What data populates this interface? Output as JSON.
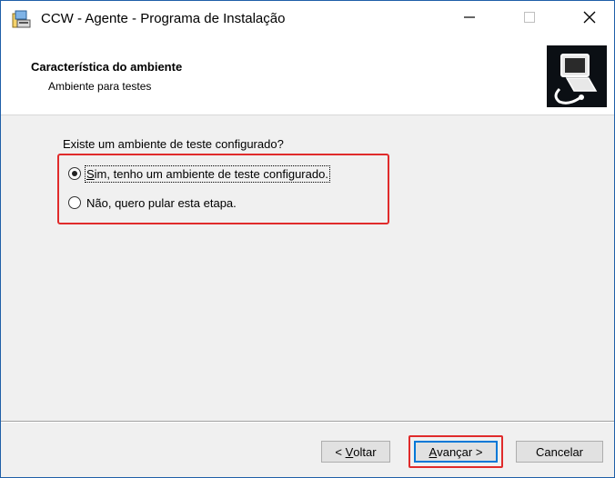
{
  "window": {
    "title": "CCW - Agente - Programa de Instalação",
    "controls": {
      "minimize_glyph": "—",
      "maximize_glyph": "☐",
      "close_glyph": "✕"
    }
  },
  "header": {
    "title": "Característica do ambiente",
    "subtitle": "Ambiente para testes",
    "image_icon": "computer-installer-icon"
  },
  "content": {
    "question": "Existe um ambiente de teste configurado?",
    "options": [
      {
        "accel": "S",
        "rest": "im, tenho um ambiente de teste configurado.",
        "selected": true
      },
      {
        "label": "Não, quero pular esta etapa.",
        "selected": false
      }
    ]
  },
  "footer": {
    "back": {
      "prefix": "< ",
      "accel": "V",
      "rest": "oltar"
    },
    "next": {
      "accel": "A",
      "rest": "vançar >"
    },
    "cancel": {
      "label": "Cancelar"
    }
  },
  "colors": {
    "annotation_red": "#e02b2b",
    "window_border": "#1f5fa8",
    "default_button_border": "#0078d7"
  }
}
